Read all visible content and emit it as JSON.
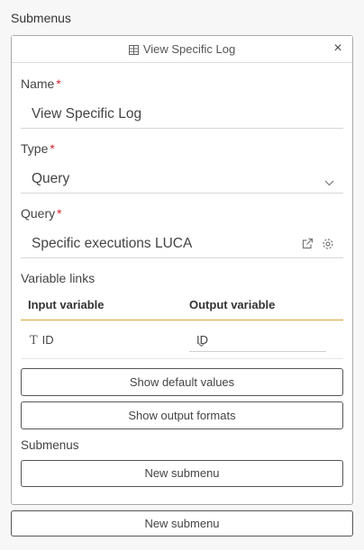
{
  "section_title": "Submenus",
  "panel": {
    "title": "View Specific Log",
    "close_glyph": "×",
    "fields": {
      "name": {
        "label": "Name",
        "required_mark": "*",
        "value": "View Specific Log"
      },
      "type": {
        "label": "Type",
        "required_mark": "*",
        "value": "Query"
      },
      "query": {
        "label": "Query",
        "required_mark": "*",
        "value": "Specific executions  LUCA"
      }
    },
    "variable_links": {
      "label": "Variable links",
      "columns": [
        "Input variable",
        "Output variable"
      ],
      "rows": [
        {
          "input": "ID",
          "output": "ID"
        }
      ]
    },
    "buttons": {
      "show_default_values": "Show default values",
      "show_output_formats": "Show output formats"
    },
    "submenus": {
      "label": "Submenus",
      "new_button": "New submenu"
    }
  },
  "bottom_new_button": "New submenu",
  "colors": {
    "required": "#d4262e",
    "accent_line": "#d7a53c"
  },
  "icons": [
    "table-icon",
    "close-icon",
    "chevron-down-icon",
    "external-link-icon",
    "gear-icon",
    "text-type-icon"
  ]
}
